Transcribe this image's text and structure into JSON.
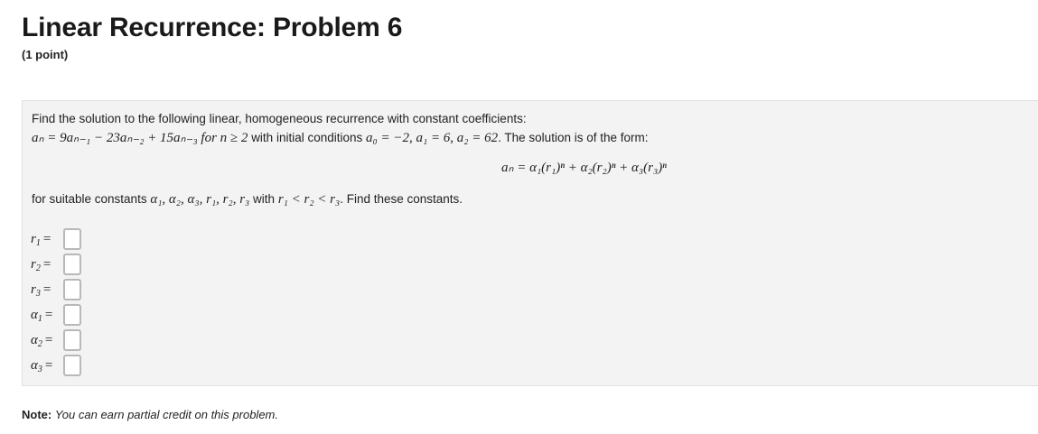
{
  "header": {
    "title": "Linear Recurrence: Problem 6",
    "points": "(1 point)"
  },
  "problem": {
    "intro": "Find the solution to the following linear, homogeneous recurrence with constant coefficients:",
    "recurrence": "aₙ = 9aₙ₋₁ − 23aₙ₋₂ + 15aₙ₋₃ for n ≥ 2",
    "initial_conditions_text": "with initial conditions",
    "initial_conditions": "a₀ = −2, a₁ = 6, a₂ = 62",
    "form_text": ". The solution is of the form:",
    "solution_form": "aₙ = α₁(r₁)ⁿ + α₂(r₂)ⁿ + α₃(r₃)ⁿ",
    "constants_text_before": "for suitable constants",
    "constants": "α₁, α₂, α₃, r₁, r₂, r₃",
    "constants_text_with": "with",
    "ordering": "r₁ < r₂ < r₃",
    "constants_text_after": ". Find these constants."
  },
  "answers": [
    {
      "var": "r",
      "sub": "1",
      "value": ""
    },
    {
      "var": "r",
      "sub": "2",
      "value": ""
    },
    {
      "var": "r",
      "sub": "3",
      "value": ""
    },
    {
      "var": "α",
      "sub": "1",
      "value": ""
    },
    {
      "var": "α",
      "sub": "2",
      "value": ""
    },
    {
      "var": "α",
      "sub": "3",
      "value": ""
    }
  ],
  "note": {
    "label": "Note:",
    "text": "You can earn partial credit on this problem."
  }
}
